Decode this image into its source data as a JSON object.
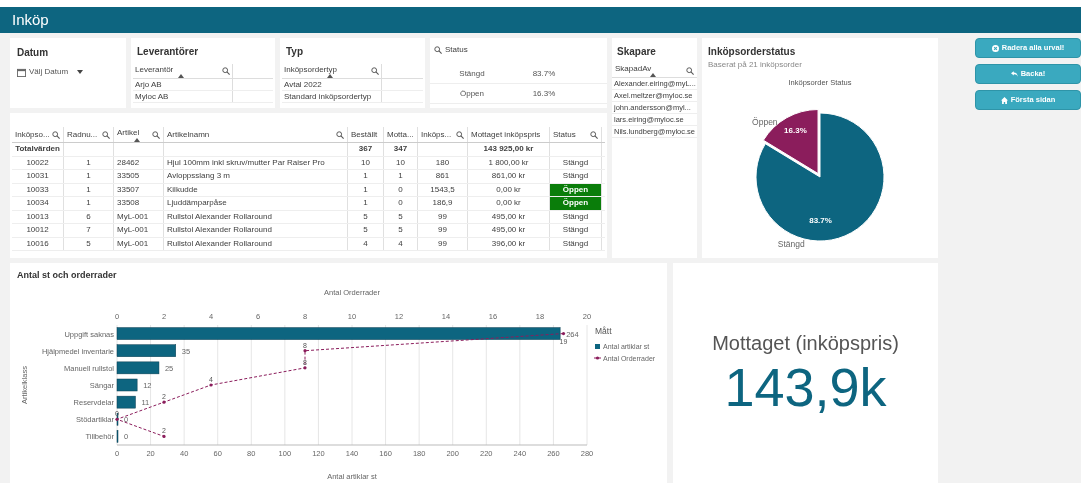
{
  "header": {
    "title": "Inköp"
  },
  "filters": {
    "datum": {
      "title": "Datum",
      "picker_label": "Välj Datum"
    },
    "leverantorer": {
      "title": "Leverantörer",
      "column": "Leverantör",
      "items": [
        "Arjo AB",
        "Myloc AB"
      ]
    },
    "typ": {
      "title": "Typ",
      "column": "Inköpsordertyp",
      "items": [
        "Avtal 2022",
        "Standard inköpsordertyp"
      ]
    },
    "status": {
      "title": "Status",
      "rows": [
        {
          "label": "Stängd",
          "share": "83.7%"
        },
        {
          "label": "Öppen",
          "share": "16.3%"
        }
      ]
    },
    "skapare": {
      "title": "Skapare",
      "column": "SkapadAv",
      "items": [
        "Alexander.eiring@myL...",
        "Axel.meltzer@myloc.se",
        "john.andersson@myl...",
        "lars.eiring@myloc.se",
        "Nils.lundberg@myloc.se"
      ]
    }
  },
  "buttons": [
    {
      "label": "Radera alla urval!",
      "kind": "clear"
    },
    {
      "label": "Backa!",
      "kind": "back"
    },
    {
      "label": "Första sidan",
      "kind": "home"
    }
  ],
  "table": {
    "columns": [
      {
        "label": "Inköpso...",
        "searchable": true,
        "sorted": false
      },
      {
        "label": "Radnu...",
        "searchable": true,
        "sorted": false
      },
      {
        "label": "Artikel",
        "searchable": true,
        "sorted": true
      },
      {
        "label": "Artikelnamn",
        "searchable": true,
        "sorted": false
      },
      {
        "label": "Beställt",
        "searchable": false,
        "sorted": false
      },
      {
        "label": "Motta...",
        "searchable": false,
        "sorted": false
      },
      {
        "label": "Inköps...",
        "searchable": true,
        "sorted": false
      },
      {
        "label": "Mottaget inköpspris",
        "searchable": false,
        "sorted": false
      },
      {
        "label": "Status",
        "searchable": true,
        "sorted": false
      }
    ],
    "totals": {
      "label": "Totalvärden",
      "bestallt": "367",
      "mottaget": "347",
      "mottaget_inkopspris": "143 925,00 kr"
    },
    "rows": [
      {
        "cells": [
          "10022",
          "1",
          "28462",
          "Hjul 100mm inkl skruv/mutter Par Raiser Pro",
          "10",
          "10",
          "180",
          "1 800,00 kr",
          "Stängd"
        ],
        "open": false
      },
      {
        "cells": [
          "10031",
          "1",
          "33505",
          "Avloppsslang 3 m",
          "1",
          "1",
          "861",
          "861,00 kr",
          "Stängd"
        ],
        "open": false
      },
      {
        "cells": [
          "10033",
          "1",
          "33507",
          "Kilkudde",
          "1",
          "0",
          "1543,5",
          "0,00 kr",
          "Öppen"
        ],
        "open": true
      },
      {
        "cells": [
          "10034",
          "1",
          "33508",
          "Ljuddämparpåse",
          "1",
          "0",
          "186,9",
          "0,00 kr",
          "Öppen"
        ],
        "open": true
      },
      {
        "cells": [
          "10013",
          "6",
          "MyL-001",
          "Rullstol Alexander Rollaround",
          "5",
          "5",
          "99",
          "495,00 kr",
          "Stängd"
        ],
        "open": false
      },
      {
        "cells": [
          "10012",
          "7",
          "MyL-001",
          "Rullstol Alexander Rollaround",
          "5",
          "5",
          "99",
          "495,00 kr",
          "Stängd"
        ],
        "open": false
      },
      {
        "cells": [
          "10016",
          "5",
          "MyL-001",
          "Rullstol Alexander Rollaround",
          "4",
          "4",
          "99",
          "396,00 kr",
          "Stängd"
        ],
        "open": false
      }
    ]
  },
  "status_panel": {
    "title": "Inköpsorderstatus",
    "subtitle": "Baserat på 21 inköpsorder",
    "chart_data": {
      "type": "pie",
      "title": "Inköpsorder Status",
      "categories": [
        "Öppen",
        "Stängd"
      ],
      "series": [
        {
          "values": [
            16.3,
            83.7
          ],
          "colors": [
            "#8b1d5c",
            "#0d6580"
          ]
        }
      ],
      "value_labels": [
        "16.3%",
        "83.7%"
      ]
    }
  },
  "bar_panel": {
    "title": "Antal st och orderrader",
    "legend_title": "Mått",
    "chart_data": {
      "type": "bar",
      "orientation": "horizontal",
      "ylabel": "Artikelklass",
      "xlabel": "Antal artiklar st",
      "categories": [
        "Uppgift saknas",
        "Hjälpmedel inventarie",
        "Manuell rullstol",
        "Sängar",
        "Reservdelar",
        "Stödartiklar",
        "Tillbehör"
      ],
      "series": [
        {
          "name": "Antal artiklar st",
          "color": "#0d6580",
          "values": [
            264,
            35,
            25,
            12,
            11,
            0,
            0
          ]
        }
      ],
      "xlim": [
        0,
        280
      ],
      "xticks": [
        0,
        20,
        40,
        60,
        80,
        100,
        120,
        140,
        160,
        180,
        200,
        220,
        240,
        260,
        280
      ],
      "grid": true,
      "data_labels": true
    },
    "overlay": {
      "chart_data": {
        "type": "line",
        "orientation": "horizontal",
        "xlabel": "Antal Orderrader",
        "series": [
          {
            "name": "Antal Orderrader",
            "color": "#8b1d5c",
            "line_style": "dashed",
            "values": [
              19,
              8,
              8,
              4,
              2,
              0,
              2
            ]
          }
        ],
        "xlim": [
          0,
          20
        ],
        "xticks": [
          0,
          2,
          4,
          6,
          8,
          10,
          12,
          14,
          16,
          18,
          20
        ],
        "data_labels": true
      }
    }
  },
  "kpi": {
    "label": "Mottaget (inköpspris)",
    "value": "143,9k"
  }
}
